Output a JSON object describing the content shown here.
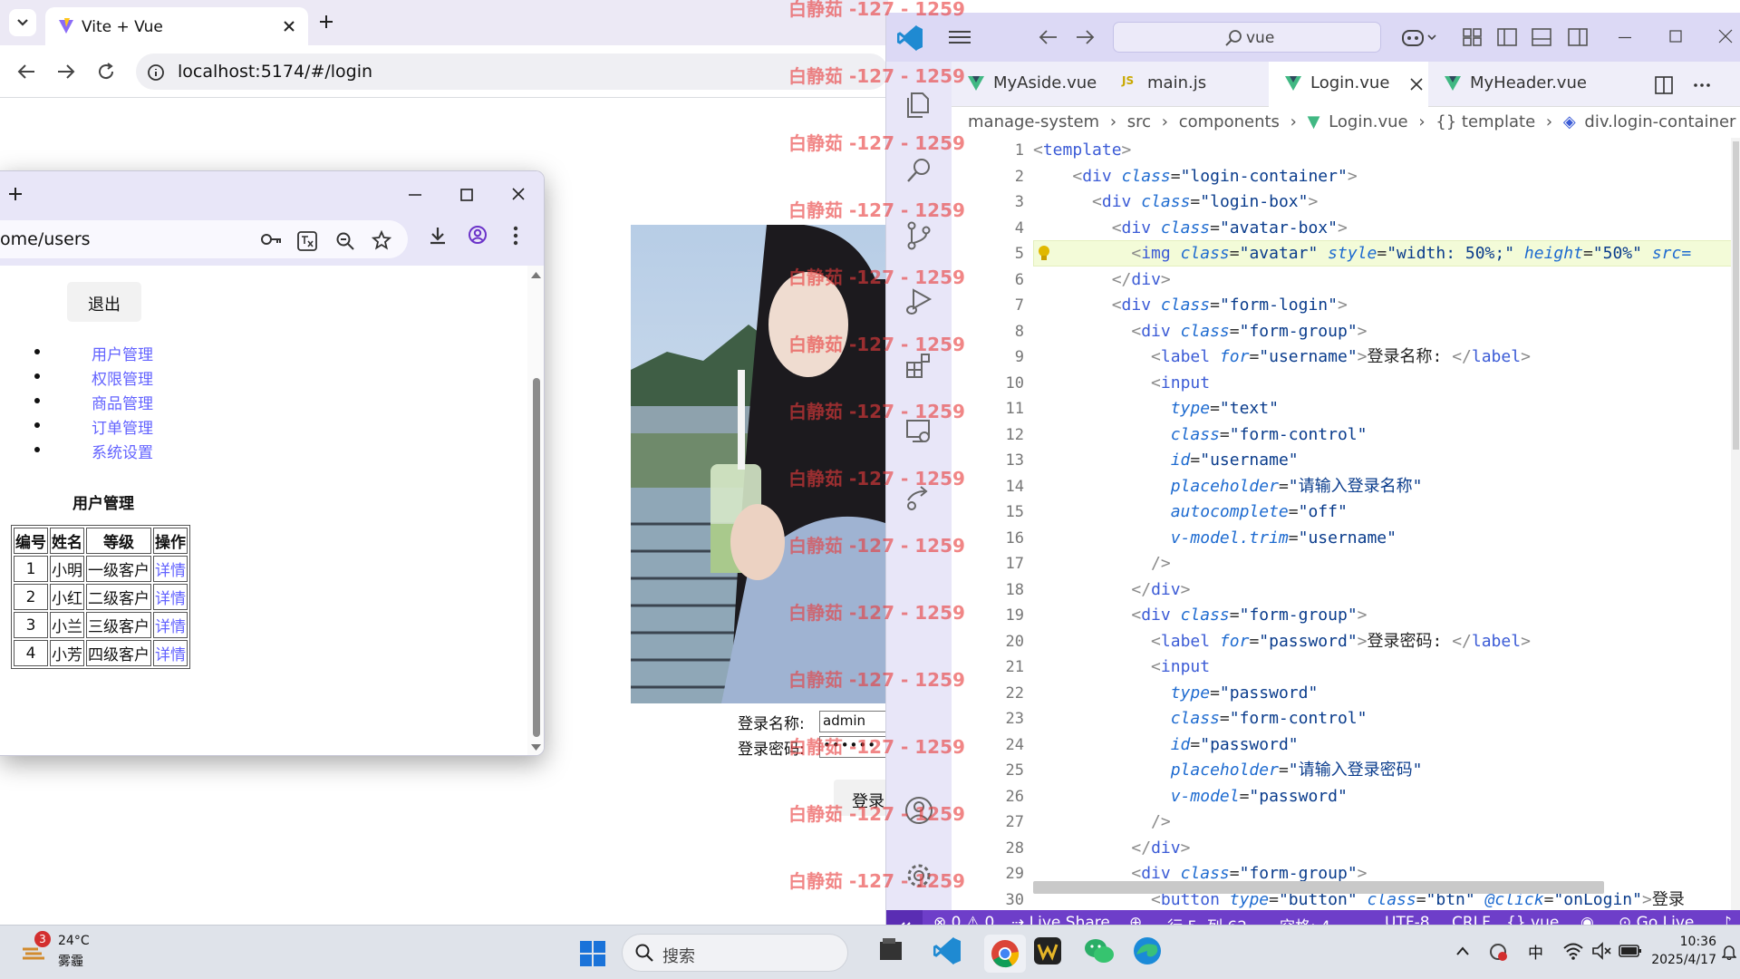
{
  "browser": {
    "tab_title": "Vite + Vue",
    "url": "localhost:5174/#/login",
    "login_form": {
      "username_label": "登录名称:",
      "username_value": "admin",
      "password_label": "登录密码:",
      "password_value": "••••••",
      "submit_label": "登录"
    }
  },
  "popup": {
    "url": "ome/users",
    "logout_label": "退出",
    "menu": [
      "用户管理",
      "权限管理",
      "商品管理",
      "订单管理",
      "系统设置"
    ],
    "section_title": "用户管理",
    "table": {
      "headers": [
        "编号",
        "姓名",
        "等级",
        "操作"
      ],
      "rows": [
        [
          "1",
          "小明",
          "一级客户",
          "详情"
        ],
        [
          "2",
          "小红",
          "二级客户",
          "详情"
        ],
        [
          "3",
          "小兰",
          "三级客户",
          "详情"
        ],
        [
          "4",
          "小芳",
          "四级客户",
          "详情"
        ]
      ]
    }
  },
  "vscode": {
    "search_text": "vue",
    "tabs": [
      "MyAside.vue",
      "main.js",
      "Login.vue",
      "MyHeader.vue"
    ],
    "active_tab": "Login.vue",
    "breadcrumb": [
      "manage-system",
      "src",
      "components",
      "Login.vue",
      "{} template",
      "div.login-container"
    ],
    "line_numbers": [
      "1",
      "2",
      "3",
      "4",
      "5",
      "6",
      "7",
      "8",
      "9",
      "10",
      "11",
      "12",
      "13",
      "14",
      "15",
      "16",
      "17",
      "18",
      "19",
      "20",
      "21",
      "22",
      "23",
      "24",
      "25",
      "26",
      "27",
      "28",
      "29",
      "30"
    ],
    "status": {
      "errors": "0",
      "warnings": "0",
      "live_share": "Live Share",
      "cursor": "行 5, 列 62",
      "spaces": "空格: 4",
      "encoding": "UTF-8",
      "eol": "CRLF",
      "language": "vue",
      "go_live": "Go Live"
    }
  },
  "taskbar": {
    "weather_badge": "3",
    "temperature": "24°C",
    "weather": "雾霾",
    "search_placeholder": "搜索",
    "ime": "中",
    "time": "10:36",
    "date": "2025/4/17"
  },
  "watermark": "白静茹 -127 - 1259",
  "colors": {
    "vscode_status": "#6e3ec9",
    "link": "#6363ff",
    "watermark": "#e83c3c"
  }
}
